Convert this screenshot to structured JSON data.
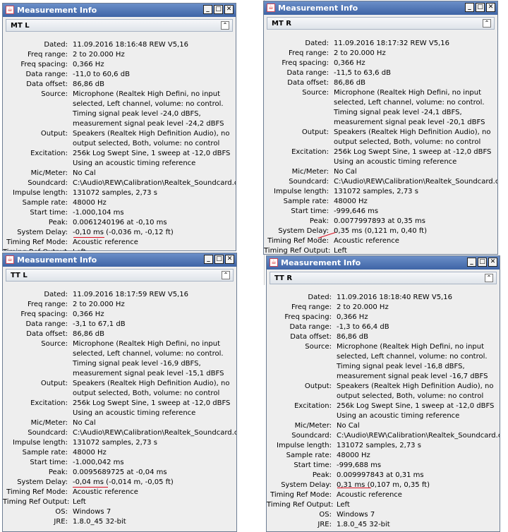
{
  "window_title": "Measurement Info",
  "title_buttons": [
    "_",
    "□",
    "✕"
  ],
  "collapse_glyph": "⌃",
  "windows": [
    {
      "name": "MT L",
      "rows": [
        {
          "label": "Dated:",
          "value": "11.09.2016 18:16:48 REW V5,16"
        },
        {
          "label": "Freq range:",
          "value": "2 to 20.000 Hz"
        },
        {
          "label": "Freq spacing:",
          "value": "0,366 Hz"
        },
        {
          "label": "Data range:",
          "value": "-11,0 to 60,6 dB"
        },
        {
          "label": "Data offset:",
          "value": "86,86 dB"
        },
        {
          "label": "Source:",
          "value": "Microphone (Realtek High Defini, no input\nselected, Left channel, volume: no control.\nTiming signal peak level -24,0 dBFS,\nmeasurement signal peak level -24,2 dBFS"
        },
        {
          "label": "Output:",
          "value": "Speakers (Realtek High Definition Audio), no\noutput selected, Both, volume: no control"
        },
        {
          "label": "Excitation:",
          "value": " 256k Log Swept Sine, 1 sweep at -12,0 dBFS\nUsing an acoustic timing reference"
        },
        {
          "label": "Mic/Meter:",
          "value": "No Cal"
        },
        {
          "label": "Soundcard:",
          "value": "C:\\Audio\\REW\\Calibration\\Realtek_Soundcard.cal"
        },
        {
          "label": "Impulse length:",
          "value": "131072 samples, 2,73 s"
        },
        {
          "label": "Sample rate:",
          "value": "48000 Hz"
        },
        {
          "label": "Start time:",
          "value": "-1.000,104 ms"
        },
        {
          "label": "Peak:",
          "value": "0.0061240196 at -0,10 ms"
        },
        {
          "label": "System Delay:",
          "value": "-0,10 ms (-0,036 m, -0,12 ft)"
        },
        {
          "label": "Timing Ref Mode:",
          "value": "Acoustic reference"
        },
        {
          "label": "Timing Ref Output:",
          "value": "Left"
        }
      ]
    },
    {
      "name": "MT R",
      "rows": [
        {
          "label": "Dated:",
          "value": "11.09.2016 18:17:32 REW V5,16"
        },
        {
          "label": "Freq range:",
          "value": "2 to 20.000 Hz"
        },
        {
          "label": "Freq spacing:",
          "value": "0,366 Hz"
        },
        {
          "label": "Data range:",
          "value": "-11,5 to 63,6 dB"
        },
        {
          "label": "Data offset:",
          "value": "86,86 dB"
        },
        {
          "label": "Source:",
          "value": "Microphone (Realtek High Defini, no input\nselected, Left channel, volume: no control.\nTiming signal peak level -24,1 dBFS,\nmeasurement signal peak level -20,1 dBFS"
        },
        {
          "label": "Output:",
          "value": "Speakers (Realtek High Definition Audio), no\noutput selected, Both, volume: no control"
        },
        {
          "label": "Excitation:",
          "value": " 256k Log Swept Sine, 1 sweep at -12,0 dBFS\nUsing an acoustic timing reference"
        },
        {
          "label": "Mic/Meter:",
          "value": "No Cal"
        },
        {
          "label": "Soundcard:",
          "value": "C:\\Audio\\REW\\Calibration\\Realtek_Soundcard.cal"
        },
        {
          "label": "Impulse length:",
          "value": "131072 samples, 2,73 s"
        },
        {
          "label": "Sample rate:",
          "value": "48000 Hz"
        },
        {
          "label": "Start time:",
          "value": "-999,646 ms"
        },
        {
          "label": "Peak:",
          "value": "0.0077997893 at 0,35 ms"
        },
        {
          "label": "System Delay:",
          "value": "0,35 ms (0,121 m, 0,40 ft)"
        },
        {
          "label": "Timing Ref Mode:",
          "value": "Acoustic reference"
        },
        {
          "label": "Timing Ref Output:",
          "value": "Left"
        }
      ]
    },
    {
      "name": "TT L",
      "rows": [
        {
          "label": "Dated:",
          "value": "11.09.2016 18:17:59 REW V5,16"
        },
        {
          "label": "Freq range:",
          "value": "2 to 20.000 Hz"
        },
        {
          "label": "Freq spacing:",
          "value": "0,366 Hz"
        },
        {
          "label": "Data range:",
          "value": "-3,1 to 67,1 dB"
        },
        {
          "label": "Data offset:",
          "value": "86,86 dB"
        },
        {
          "label": "Source:",
          "value": "Microphone (Realtek High Defini, no input\nselected, Left channel, volume: no control.\nTiming signal peak level -16,9 dBFS,\nmeasurement signal peak level -15,1 dBFS"
        },
        {
          "label": "Output:",
          "value": "Speakers (Realtek High Definition Audio), no\noutput selected, Both, volume: no control"
        },
        {
          "label": "Excitation:",
          "value": " 256k Log Swept Sine, 1 sweep at -12,0 dBFS\nUsing an acoustic timing reference"
        },
        {
          "label": "Mic/Meter:",
          "value": "No Cal"
        },
        {
          "label": "Soundcard:",
          "value": "C:\\Audio\\REW\\Calibration\\Realtek_Soundcard.cal"
        },
        {
          "label": "Impulse length:",
          "value": "131072 samples, 2,73 s"
        },
        {
          "label": "Sample rate:",
          "value": "48000 Hz"
        },
        {
          "label": "Start time:",
          "value": "-1.000,042 ms"
        },
        {
          "label": "Peak:",
          "value": "0.0095689725 at -0,04 ms"
        },
        {
          "label": "System Delay:",
          "value": "-0,04 ms (-0,014 m, -0,05 ft)"
        },
        {
          "label": "Timing Ref Mode:",
          "value": "Acoustic reference"
        },
        {
          "label": "Timing Ref Output:",
          "value": "Left"
        },
        {
          "label": "OS:",
          "value": "Windows 7"
        },
        {
          "label": "JRE:",
          "value": "1.8.0_45 32-bit"
        }
      ]
    },
    {
      "name": "TT R",
      "rows": [
        {
          "label": "Dated:",
          "value": "11.09.2016 18:18:40 REW V5,16"
        },
        {
          "label": "Freq range:",
          "value": "2 to 20.000 Hz"
        },
        {
          "label": "Freq spacing:",
          "value": "0,366 Hz"
        },
        {
          "label": "Data range:",
          "value": "-1,3 to 66,4 dB"
        },
        {
          "label": "Data offset:",
          "value": "86,86 dB"
        },
        {
          "label": "Source:",
          "value": "Microphone (Realtek High Defini, no input\nselected, Left channel, volume: no control.\nTiming signal peak level -16,8 dBFS,\nmeasurement signal peak level -16,7 dBFS"
        },
        {
          "label": "Output:",
          "value": "Speakers (Realtek High Definition Audio), no\noutput selected, Both, volume: no control"
        },
        {
          "label": "Excitation:",
          "value": " 256k Log Swept Sine, 1 sweep at -12,0 dBFS\nUsing an acoustic timing reference"
        },
        {
          "label": "Mic/Meter:",
          "value": "No Cal"
        },
        {
          "label": "Soundcard:",
          "value": "C:\\Audio\\REW\\Calibration\\Realtek_Soundcard.cal"
        },
        {
          "label": "Impulse length:",
          "value": "131072 samples, 2,73 s"
        },
        {
          "label": "Sample rate:",
          "value": "48000 Hz"
        },
        {
          "label": "Start time:",
          "value": "-999,688 ms"
        },
        {
          "label": "Peak:",
          "value": "0.009997843 at 0,31 ms"
        },
        {
          "label": "System Delay:",
          "value": "0,31 ms (0,107 m, 0,35 ft)"
        },
        {
          "label": "Timing Ref Mode:",
          "value": "Acoustic reference"
        },
        {
          "label": "Timing Ref Output:",
          "value": "Left"
        },
        {
          "label": "OS:",
          "value": "Windows 7"
        },
        {
          "label": "JRE:",
          "value": "1.8.0_45 32-bit"
        }
      ]
    }
  ]
}
